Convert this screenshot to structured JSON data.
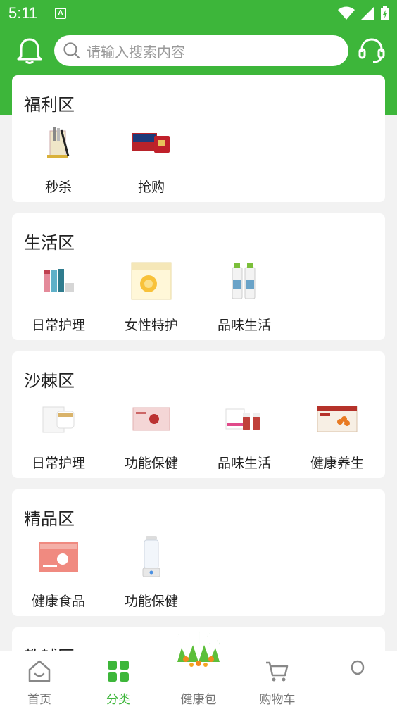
{
  "status_bar": {
    "time": "5:11",
    "notif_letter": "A"
  },
  "search": {
    "placeholder": "请输入搜索内容"
  },
  "sections": [
    {
      "title": "福利区",
      "items": [
        {
          "label": "秒杀"
        },
        {
          "label": "抢购"
        }
      ]
    },
    {
      "title": "生活区",
      "items": [
        {
          "label": "日常护理"
        },
        {
          "label": "女性特护"
        },
        {
          "label": "品味生活"
        }
      ]
    },
    {
      "title": "沙棘区",
      "items": [
        {
          "label": "日常护理"
        },
        {
          "label": "功能保健"
        },
        {
          "label": "品味生活"
        },
        {
          "label": "健康养生"
        }
      ]
    },
    {
      "title": "精品区",
      "items": [
        {
          "label": "健康食品"
        },
        {
          "label": "功能保健"
        }
      ]
    },
    {
      "title": "教辅区",
      "items": []
    }
  ],
  "tabbar": {
    "home": "首页",
    "category": "分类",
    "health_pack": "健康包",
    "cart": "购物车",
    "health_logo_text": "健康包"
  },
  "colors": {
    "brand_green": "#3db63a",
    "background": "#f2f2f2"
  }
}
